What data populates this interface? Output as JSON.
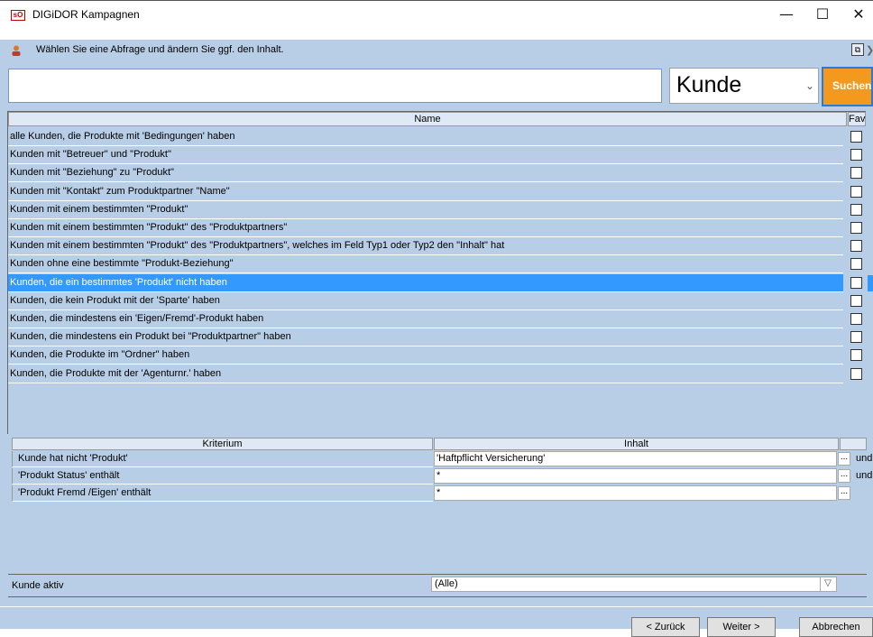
{
  "window": {
    "icon_text": "sO",
    "title": "DIGiDOR Kampagnen",
    "minimize": "—",
    "maximize": "☐",
    "close": "✕"
  },
  "info": {
    "text": "Wählen Sie eine Abfrage und ändern Sie ggf. den Inhalt."
  },
  "search": {
    "value": "",
    "placeholder": "",
    "entity_select": "Kunde",
    "button": "Suchen"
  },
  "query_table": {
    "columns": {
      "name": "Name",
      "fav": "Fav"
    },
    "selected_index": 8,
    "rows": [
      "alle Kunden, die Produkte mit 'Bedingungen' haben",
      "Kunden mit \"Betreuer\" und \"Produkt\"",
      "Kunden mit \"Beziehung\" zu \"Produkt\"",
      "Kunden mit \"Kontakt\" zum Produktpartner \"Name\"",
      "Kunden mit einem bestimmten \"Produkt\"",
      "Kunden mit einem bestimmten \"Produkt\" des \"Produktpartners\"",
      "Kunden mit einem bestimmten \"Produkt\" des \"Produktpartners\", welches im Feld Typ1 oder Typ2 den \"Inhalt\" hat",
      "Kunden ohne eine bestimmte \"Produkt-Beziehung\"",
      "Kunden, die ein bestimmtes 'Produkt' nicht haben",
      "Kunden, die kein Produkt mit der  'Sparte' haben",
      "Kunden, die mindestens ein 'Eigen/Fremd'-Produkt haben",
      "Kunden, die mindestens ein Produkt bei \"Produktpartner\" haben",
      "Kunden, die Produkte im \"Ordner\" haben",
      "Kunden, die Produkte mit der 'Agenturnr.' haben"
    ]
  },
  "criteria_table": {
    "columns": {
      "kriterium": "Kriterium",
      "inhalt": "Inhalt"
    },
    "rows": [
      {
        "kriterium": "Kunde hat nicht 'Produkt'",
        "inhalt": "'Haftpflicht Versicherung'",
        "dots": "...",
        "conj": "und"
      },
      {
        "kriterium": "'Produkt Status' enthält",
        "inhalt": "*",
        "dots": "...",
        "conj": "und"
      },
      {
        "kriterium": "'Produkt Fremd /Eigen' enthält",
        "inhalt": "*",
        "dots": "...",
        "conj": ""
      }
    ]
  },
  "filter": {
    "label": "Kunde aktiv",
    "value": "(Alle)"
  },
  "footer": {
    "back": "< Zurück",
    "next": "Weiter >",
    "cancel": "Abbrechen"
  },
  "colors": {
    "panel": "#b8cde6",
    "selection": "#3399ff",
    "search_button": "#f39a1e"
  }
}
